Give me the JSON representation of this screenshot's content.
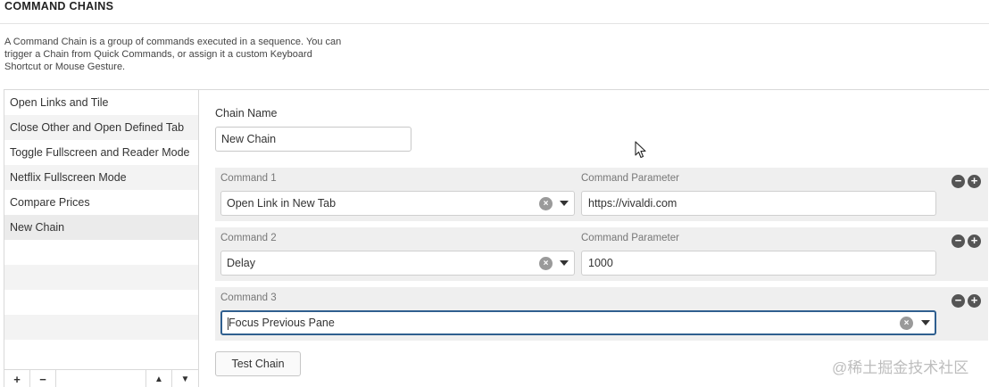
{
  "section": {
    "title": "COMMAND CHAINS",
    "description_line1": "A Command Chain is a group of commands executed in a sequence. You can",
    "description_line2": "trigger a Chain from Quick Commands, or assign it a custom Keyboard",
    "description_line3": "Shortcut or Mouse Gesture."
  },
  "chain_list": {
    "items": [
      {
        "label": "Open Links and Tile"
      },
      {
        "label": "Close Other and Open Defined Tab"
      },
      {
        "label": "Toggle Fullscreen and Reader Mode"
      },
      {
        "label": "Netflix Fullscreen Mode"
      },
      {
        "label": "Compare Prices"
      },
      {
        "label": "New Chain"
      }
    ],
    "toolbar": {
      "add": "+",
      "remove": "−",
      "move_up": "▲",
      "move_down": "▼"
    }
  },
  "editor": {
    "chain_name_label": "Chain Name",
    "chain_name_value": "New Chain",
    "commands": [
      {
        "label": "Command 1",
        "value": "Open Link in New Tab",
        "param_label": "Command Parameter",
        "param_value": "https://vivaldi.com"
      },
      {
        "label": "Command 2",
        "value": "Delay",
        "param_label": "Command Parameter",
        "param_value": "1000"
      },
      {
        "label": "Command 3",
        "value": "Focus Previous Pane"
      }
    ],
    "row_buttons": {
      "remove": "−",
      "add": "+"
    },
    "clear_glyph": "×",
    "test_button": "Test Chain"
  },
  "watermark": "@稀土掘金技术社区",
  "colors": {
    "focus_border": "#2f5f8f",
    "row_background": "#efefef",
    "selected_item": "#ebebeb"
  }
}
